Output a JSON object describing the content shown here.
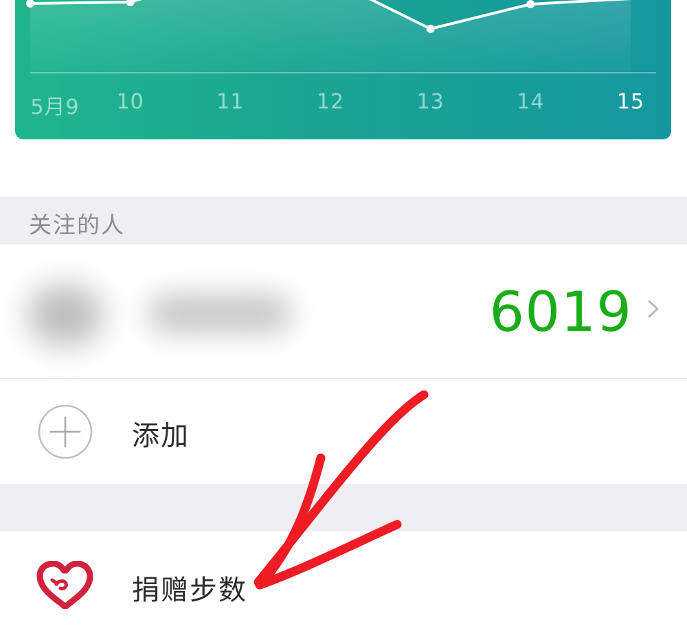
{
  "chart_data": {
    "type": "line",
    "categories": [
      "5月9",
      "10",
      "11",
      "12",
      "13",
      "14",
      "15"
    ],
    "active_category": "15",
    "colors": {
      "line": "#ffffff",
      "background_start": "#20b58e",
      "background_end": "#1597a0"
    }
  },
  "friends": {
    "section_title": "关注的人",
    "rows": [
      {
        "steps": "6019",
        "icon": "chevron-right-icon"
      }
    ],
    "steps_color": "#1aad19"
  },
  "actions": {
    "add_label": "添加",
    "add_icon": "plus-circle-icon",
    "donate_label": "捐赠步数",
    "donate_icon": "heart-icon",
    "donate_icon_color": "#d2233c"
  },
  "annotation": {
    "type": "arrow",
    "color": "#ee1c24"
  }
}
